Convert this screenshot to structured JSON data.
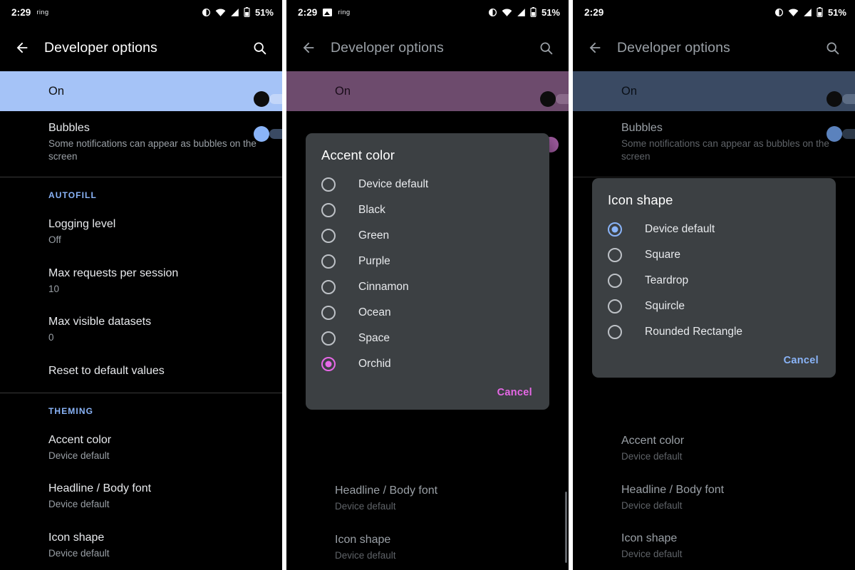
{
  "colors": {
    "accent_blue": "#8ab4f8",
    "accent_orchid": "#e668e6",
    "master_on_blue": "#a5c3f7",
    "master_on_purple": "#6d4b6d",
    "master_on_slate": "#3a4a63",
    "dialog_bg": "#3c4043",
    "page_bg": "#000000"
  },
  "panels": [
    {
      "id": "panel-list",
      "statusbar": {
        "time": "2:29",
        "ring_label": "ring",
        "has_photo_icon": false,
        "icons": [
          "dnd-icon",
          "wifi-icon",
          "cellular-signal-icon",
          "battery-icon"
        ],
        "battery_percent": "51%"
      },
      "appbar": {
        "back_icon": "arrow-back-icon",
        "title": "Developer options",
        "search_icon": "search-icon"
      },
      "master_switch": {
        "label": "On",
        "checked": true
      },
      "items": [
        {
          "type": "switch-row",
          "title": "Bubbles",
          "summary": "Some notifications can appear as bubbles on the screen",
          "checked": true
        },
        {
          "type": "divider"
        },
        {
          "type": "section",
          "title": "AUTOFILL"
        },
        {
          "type": "row",
          "title": "Logging level",
          "summary": "Off"
        },
        {
          "type": "row",
          "title": "Max requests per session",
          "summary": "10"
        },
        {
          "type": "row",
          "title": "Max visible datasets",
          "summary": "0"
        },
        {
          "type": "row",
          "title": "Reset to default values",
          "summary": ""
        },
        {
          "type": "divider"
        },
        {
          "type": "section",
          "title": "THEMING"
        },
        {
          "type": "row",
          "title": "Accent color",
          "summary": "Device default"
        },
        {
          "type": "row",
          "title": "Headline / Body font",
          "summary": "Device default"
        },
        {
          "type": "row",
          "title": "Icon shape",
          "summary": "Device default"
        }
      ]
    },
    {
      "id": "panel-accent-dialog",
      "statusbar": {
        "time": "2:29",
        "ring_label": "ring",
        "has_photo_icon": true,
        "icons": [
          "dnd-icon",
          "wifi-icon",
          "cellular-signal-icon",
          "battery-icon"
        ],
        "battery_percent": "51%"
      },
      "appbar": {
        "back_icon": "arrow-back-icon",
        "title": "Developer options",
        "search_icon": "search-icon"
      },
      "master_switch": {
        "label": "On",
        "checked": true
      },
      "background_items": [
        {
          "type": "row",
          "title": "Headline / Body font",
          "summary": "Device default"
        },
        {
          "type": "row",
          "title": "Icon shape",
          "summary": "Device default"
        }
      ],
      "dialog": {
        "title": "Accent color",
        "accent": "#e668e6",
        "options": [
          {
            "label": "Device default",
            "selected": false
          },
          {
            "label": "Black",
            "selected": false
          },
          {
            "label": "Green",
            "selected": false
          },
          {
            "label": "Purple",
            "selected": false
          },
          {
            "label": "Cinnamon",
            "selected": false
          },
          {
            "label": "Ocean",
            "selected": false
          },
          {
            "label": "Space",
            "selected": false
          },
          {
            "label": "Orchid",
            "selected": true
          }
        ],
        "cancel_label": "Cancel"
      }
    },
    {
      "id": "panel-iconshape-dialog",
      "statusbar": {
        "time": "2:29",
        "ring_label": "",
        "has_photo_icon": false,
        "icons": [
          "dnd-icon",
          "wifi-icon",
          "cellular-signal-icon",
          "battery-icon"
        ],
        "battery_percent": "51%"
      },
      "appbar": {
        "back_icon": "arrow-back-icon",
        "title": "Developer options",
        "search_icon": "search-icon"
      },
      "master_switch": {
        "label": "On",
        "checked": true
      },
      "background_items": [
        {
          "type": "switch-row",
          "title": "Bubbles",
          "summary": "Some notifications can appear as bubbles on the screen",
          "checked": true
        },
        {
          "type": "row",
          "title": "Accent color",
          "summary": "Device default"
        },
        {
          "type": "row",
          "title": "Headline / Body font",
          "summary": "Device default"
        },
        {
          "type": "row",
          "title": "Icon shape",
          "summary": "Device default"
        }
      ],
      "dialog": {
        "title": "Icon shape",
        "accent": "#8ab4f8",
        "options": [
          {
            "label": "Device default",
            "selected": true
          },
          {
            "label": "Square",
            "selected": false
          },
          {
            "label": "Teardrop",
            "selected": false
          },
          {
            "label": "Squircle",
            "selected": false
          },
          {
            "label": "Rounded Rectangle",
            "selected": false
          }
        ],
        "cancel_label": "Cancel"
      }
    }
  ]
}
